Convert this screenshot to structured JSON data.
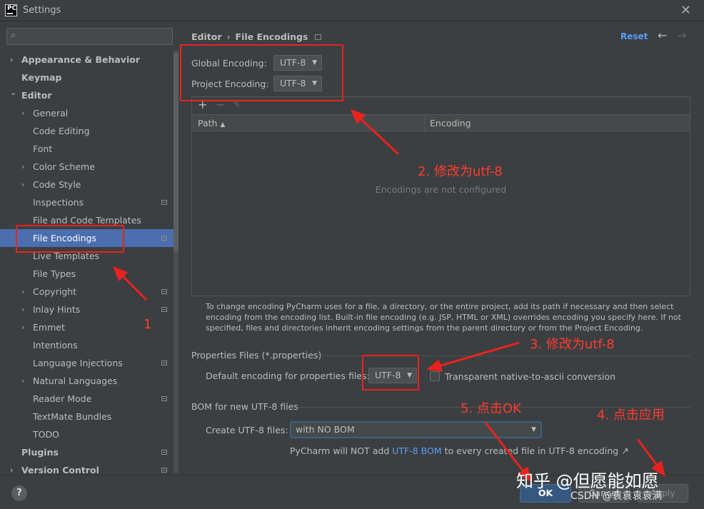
{
  "window": {
    "title": "Settings",
    "app_icon_text": "PC"
  },
  "sidebar": {
    "search_placeholder": "",
    "items": [
      {
        "label": "Appearance & Behavior",
        "level": 0,
        "chevron": "›",
        "badge": false
      },
      {
        "label": "Keymap",
        "level": 0,
        "chevron": "",
        "badge": false
      },
      {
        "label": "Editor",
        "level": 0,
        "chevron": "⌄",
        "badge": false
      },
      {
        "label": "General",
        "level": 1,
        "chevron": "›",
        "badge": false
      },
      {
        "label": "Code Editing",
        "level": 1,
        "chevron": "",
        "badge": false
      },
      {
        "label": "Font",
        "level": 1,
        "chevron": "",
        "badge": false
      },
      {
        "label": "Color Scheme",
        "level": 1,
        "chevron": "›",
        "badge": false
      },
      {
        "label": "Code Style",
        "level": 1,
        "chevron": "›",
        "badge": false
      },
      {
        "label": "Inspections",
        "level": 1,
        "chevron": "",
        "badge": true
      },
      {
        "label": "File and Code Templates",
        "level": 1,
        "chevron": "",
        "badge": false
      },
      {
        "label": "File Encodings",
        "level": 1,
        "chevron": "",
        "badge": true,
        "selected": true
      },
      {
        "label": "Live Templates",
        "level": 1,
        "chevron": "",
        "badge": false
      },
      {
        "label": "File Types",
        "level": 1,
        "chevron": "",
        "badge": false
      },
      {
        "label": "Copyright",
        "level": 1,
        "chevron": "›",
        "badge": true
      },
      {
        "label": "Inlay Hints",
        "level": 1,
        "chevron": "›",
        "badge": true
      },
      {
        "label": "Emmet",
        "level": 1,
        "chevron": "›",
        "badge": false
      },
      {
        "label": "Intentions",
        "level": 1,
        "chevron": "",
        "badge": false
      },
      {
        "label": "Language Injections",
        "level": 1,
        "chevron": "",
        "badge": true
      },
      {
        "label": "Natural Languages",
        "level": 1,
        "chevron": "›",
        "badge": false
      },
      {
        "label": "Reader Mode",
        "level": 1,
        "chevron": "",
        "badge": true
      },
      {
        "label": "TextMate Bundles",
        "level": 1,
        "chevron": "",
        "badge": false
      },
      {
        "label": "TODO",
        "level": 1,
        "chevron": "",
        "badge": false
      },
      {
        "label": "Plugins",
        "level": 0,
        "chevron": "",
        "badge": true
      },
      {
        "label": "Version Control",
        "level": 0,
        "chevron": "›",
        "badge": true
      }
    ]
  },
  "header": {
    "breadcrumb_parent": "Editor",
    "breadcrumb_sep": "›",
    "breadcrumb_current": "File Encodings",
    "reset_label": "Reset"
  },
  "encoding": {
    "global_label": "Global Encoding:",
    "global_value": "UTF-8",
    "project_label": "Project Encoding:",
    "project_value": "UTF-8"
  },
  "table": {
    "col_path": "Path",
    "col_path_sort": "▲",
    "col_encoding": "Encoding",
    "empty_text": "Encodings are not configured",
    "add_symbol": "+",
    "remove_symbol": "−"
  },
  "info_text": "To change encoding PyCharm uses for a file, a directory, or the entire project, add its path if necessary and then select encoding from the encoding list. Built-in file encoding (e.g. JSP, HTML or XML) overrides encoding you specify here. If not specified, files and directories inherit encoding settings from the parent directory or from the Project Encoding.",
  "properties": {
    "section_title": "Properties Files (*.properties)",
    "default_label": "Default encoding for properties files:",
    "default_value": "UTF-8",
    "transparent_label": "Transparent native-to-ascii conversion",
    "transparent_checked": false
  },
  "bom": {
    "section_title": "BOM for new UTF-8 files",
    "create_label": "Create UTF-8 files:",
    "create_value": "with NO BOM",
    "note_prefix": "PyCharm will NOT add",
    "note_link": "UTF-8 BOM",
    "note_suffix": "to every created file in UTF-8 encoding ↗"
  },
  "footer": {
    "help_label": "?",
    "ok_label": "OK",
    "cancel_label": "Cancel",
    "apply_label": "Apply"
  },
  "annotations": {
    "step1": "1",
    "step2": "2. 修改为utf-8",
    "step3": "3. 修改为utf-8",
    "step4": "4. 点击应用",
    "step5": "5. 点击OK",
    "color": "#e8231f"
  },
  "watermarks": {
    "zhihu": "知乎 @但愿能如愿",
    "csdn": "CSDN @袁袁袁袁满"
  },
  "colors": {
    "background": "#3c3f41",
    "selection": "#4b6eaf",
    "link": "#589df6",
    "ok_button": "#365880"
  }
}
